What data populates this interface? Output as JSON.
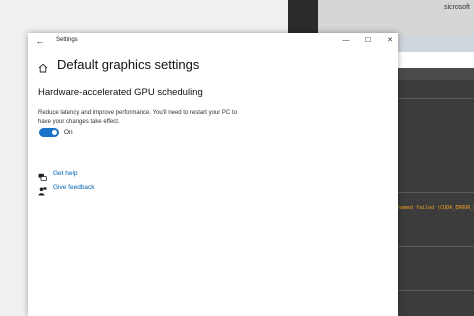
{
  "background": {
    "top_right_text": "sicrosoft",
    "error_text": "named failed (CUDA_ERROR_LAU"
  },
  "window": {
    "title": "Settings",
    "back_glyph": "←",
    "minimize_glyph": "—",
    "maximize_glyph": "☐",
    "close_glyph": "✕"
  },
  "page": {
    "title": "Default graphics settings",
    "section_title": "Hardware-accelerated GPU scheduling",
    "description": "Reduce latency and improve performance. You'll need to restart your PC to have your changes take effect.",
    "toggle_state": "On",
    "toggle_on": true
  },
  "links": {
    "get_help": "Get help",
    "give_feedback": "Give feedback"
  },
  "colors": {
    "accent": "#1a73c8",
    "link": "#0063b1",
    "error_text": "#f0a020"
  },
  "icons": {
    "home": "home-icon",
    "help": "chat-help-icon",
    "feedback": "person-feedback-icon"
  }
}
